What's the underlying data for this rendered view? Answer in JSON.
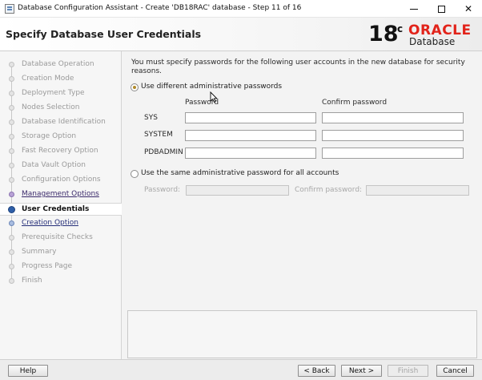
{
  "window": {
    "title": "Database Configuration Assistant - Create 'DB18RAC' database - Step 11 of 16",
    "minimize_icon": "minimize-icon",
    "maximize_icon": "maximize-icon",
    "close_icon": "close-icon",
    "close_glyph": "✕"
  },
  "header": {
    "title": "Specify Database User Credentials",
    "brand": {
      "version": "18",
      "version_sup": "c",
      "name": "ORACLE",
      "product": "Database",
      "name_color": "#e2231a"
    }
  },
  "nav": {
    "items": [
      {
        "label": "Database Operation",
        "state": "done"
      },
      {
        "label": "Creation Mode",
        "state": "done"
      },
      {
        "label": "Deployment Type",
        "state": "done"
      },
      {
        "label": "Nodes Selection",
        "state": "done"
      },
      {
        "label": "Database Identification",
        "state": "done"
      },
      {
        "label": "Storage Option",
        "state": "done"
      },
      {
        "label": "Fast Recovery Option",
        "state": "done"
      },
      {
        "label": "Data Vault Option",
        "state": "done"
      },
      {
        "label": "Configuration Options",
        "state": "done"
      },
      {
        "label": "Management Options",
        "state": "visited"
      },
      {
        "label": "User Credentials",
        "state": "current"
      },
      {
        "label": "Creation Option",
        "state": "link"
      },
      {
        "label": "Prerequisite Checks",
        "state": "pending"
      },
      {
        "label": "Summary",
        "state": "pending"
      },
      {
        "label": "Progress Page",
        "state": "pending"
      },
      {
        "label": "Finish",
        "state": "pending"
      }
    ]
  },
  "main": {
    "intro": "You must specify passwords for the following user accounts in the new database for security reasons.",
    "option_different": {
      "label": "Use different administrative passwords",
      "selected": true
    },
    "columns": {
      "password": "Password",
      "confirm": "Confirm password"
    },
    "accounts": [
      {
        "name": "SYS",
        "password": "",
        "confirm": ""
      },
      {
        "name": "SYSTEM",
        "password": "",
        "confirm": ""
      },
      {
        "name": "PDBADMIN",
        "password": "",
        "confirm": ""
      }
    ],
    "option_same": {
      "label": "Use the same administrative password for all accounts",
      "selected": false,
      "password_label": "Password:",
      "confirm_label": "Confirm password:",
      "password": "",
      "confirm": ""
    }
  },
  "buttons": {
    "help": "Help",
    "back": "< Back",
    "next": "Next >",
    "finish": "Finish",
    "cancel": "Cancel"
  }
}
